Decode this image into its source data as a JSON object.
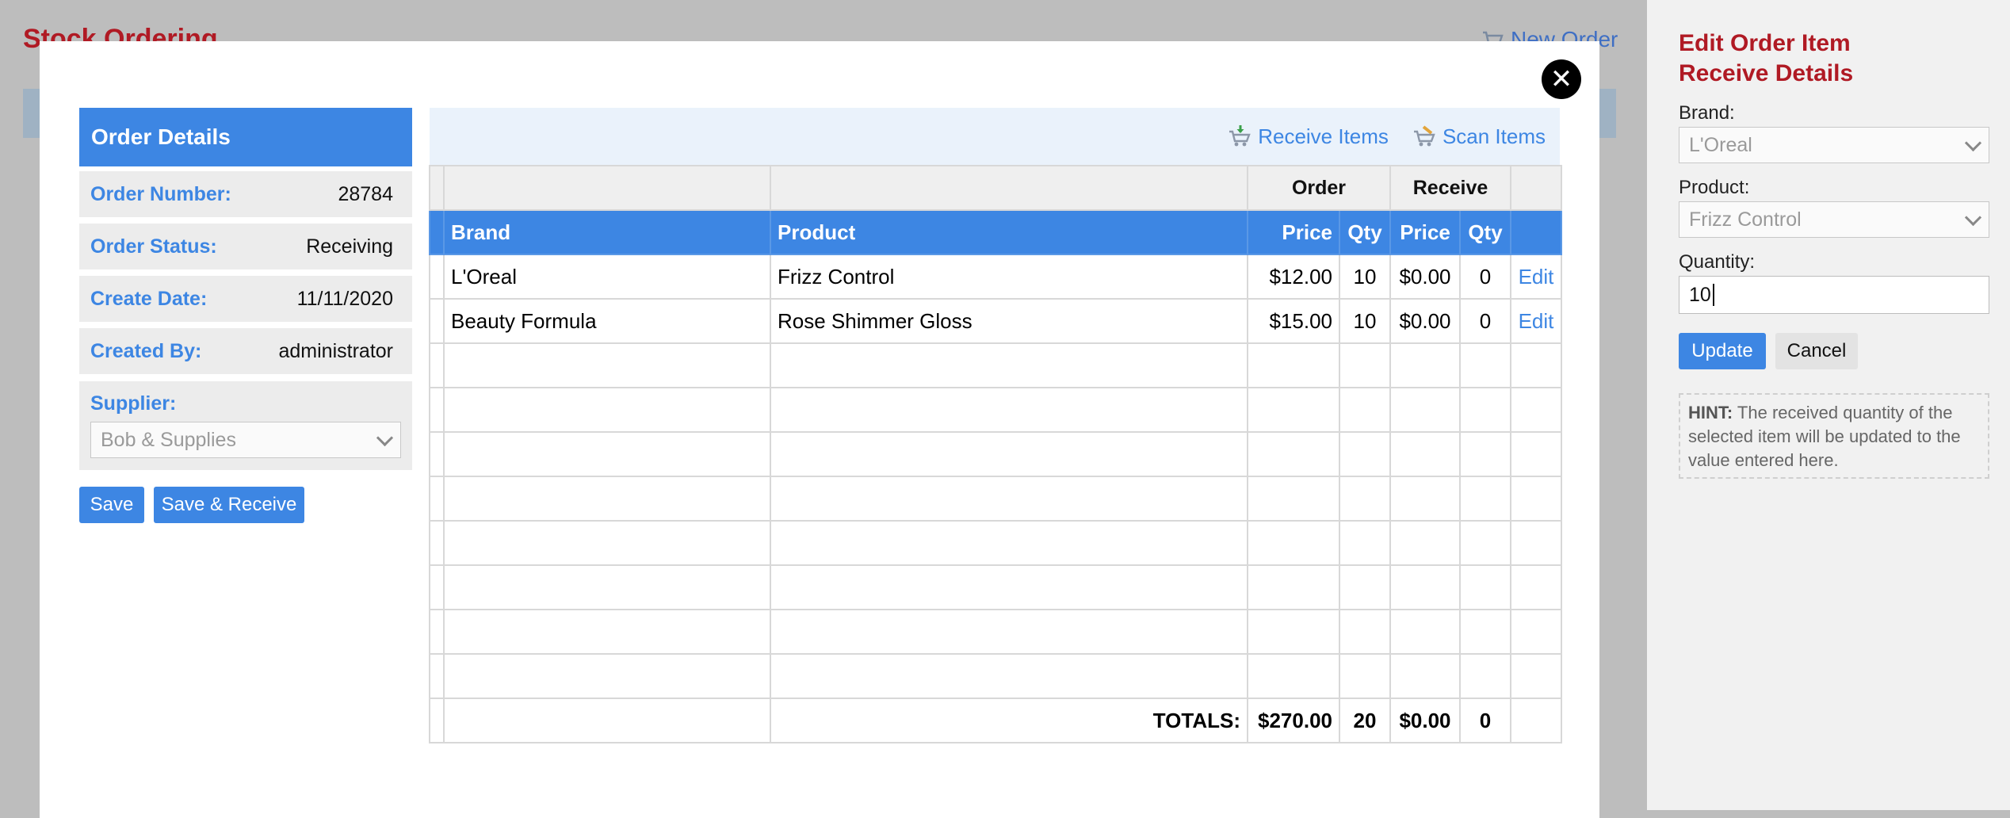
{
  "background": {
    "title": "Stock Ordering",
    "new_order_label": "New Order",
    "new_order_icon": "cart-icon"
  },
  "modal": {
    "close_icon": "close-icon",
    "order_details": {
      "header": "Order Details",
      "fields": [
        {
          "label": "Order Number:",
          "value": "28784"
        },
        {
          "label": "Order Status:",
          "value": "Receiving"
        },
        {
          "label": "Create Date:",
          "value": "11/11/2020"
        },
        {
          "label": "Created By:",
          "value": "administrator"
        }
      ],
      "supplier_label": "Supplier:",
      "supplier_value": "Bob & Supplies"
    },
    "buttons": {
      "save": "Save",
      "save_receive": "Save & Receive"
    },
    "toolbar": {
      "receive_items": "Receive Items",
      "scan_items": "Scan Items"
    },
    "table": {
      "group_headers": {
        "order": "Order",
        "receive": "Receive"
      },
      "columns": {
        "brand": "Brand",
        "product": "Product",
        "order_price": "Price",
        "order_qty": "Qty",
        "receive_price": "Price",
        "receive_qty": "Qty"
      },
      "rows": [
        {
          "brand": "L'Oreal",
          "product": "Frizz Control",
          "order_price": "$12.00",
          "order_qty": "10",
          "receive_price": "$0.00",
          "receive_qty": "0",
          "action": "Edit"
        },
        {
          "brand": "Beauty Formula",
          "product": "Rose Shimmer Gloss",
          "order_price": "$15.00",
          "order_qty": "10",
          "receive_price": "$0.00",
          "receive_qty": "0",
          "action": "Edit"
        }
      ],
      "totals": {
        "label": "TOTALS:",
        "order_price": "$270.00",
        "order_qty": "20",
        "receive_price": "$0.00",
        "receive_qty": "0"
      }
    }
  },
  "side_panel": {
    "title_line1": "Edit Order Item",
    "title_line2": "Receive Details",
    "brand_label": "Brand:",
    "brand_value": "L'Oreal",
    "product_label": "Product:",
    "product_value": "Frizz Control",
    "quantity_label": "Quantity:",
    "quantity_value": "10",
    "update_label": "Update",
    "cancel_label": "Cancel",
    "hint_label": "HINT:",
    "hint_text": " The received quantity of the selected item will be updated to the value entered here."
  },
  "colors": {
    "accent_blue": "#3d86e3",
    "title_red": "#b01a24",
    "link_blue": "#3d86e3"
  }
}
